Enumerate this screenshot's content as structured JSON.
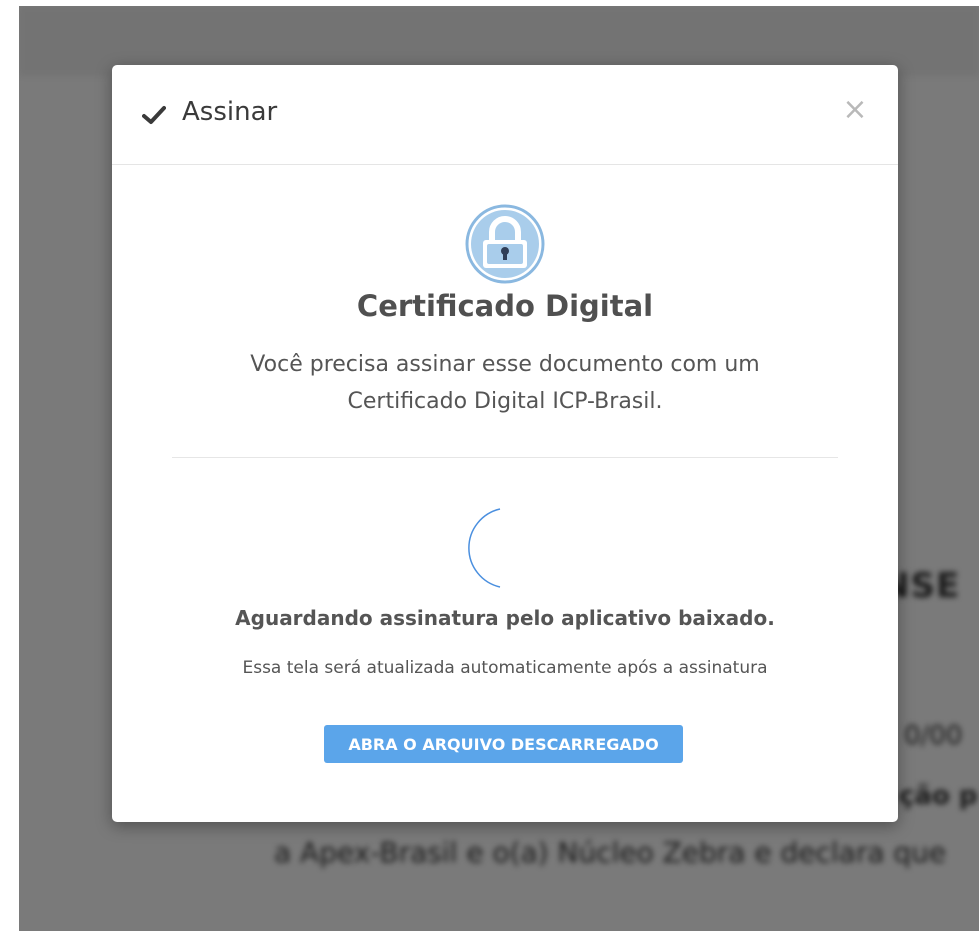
{
  "background": {
    "heading_fragment": "NSE",
    "line1_fragment": "0/00",
    "line2_fragment": "ção p",
    "line3_fragment": "a Apex-Brasil e o(a) Núcleo Zebra e declara que"
  },
  "modal": {
    "title": "Assinar",
    "header_icon": "check-icon",
    "close_icon": "close-icon",
    "close_label": "×",
    "cert_icon": "lock-icon",
    "cert_title": "Certificado Digital",
    "cert_description": "Você precisa assinar esse documento com um Certificado Digital ICP-Brasil.",
    "waiting_text": "Aguardando assinatura pelo aplicativo baixado.",
    "auto_update_text": "Essa tela será atualizada automaticamente após a assinatura",
    "open_file_button_label": "ABRA O ARQUIVO DESCARREGADO"
  },
  "colors": {
    "accent": "#5ba5ea",
    "lock_circle": "#a9cdeb",
    "lock_ring": "#8ab8e0",
    "spinner": "#4a8fdf"
  }
}
